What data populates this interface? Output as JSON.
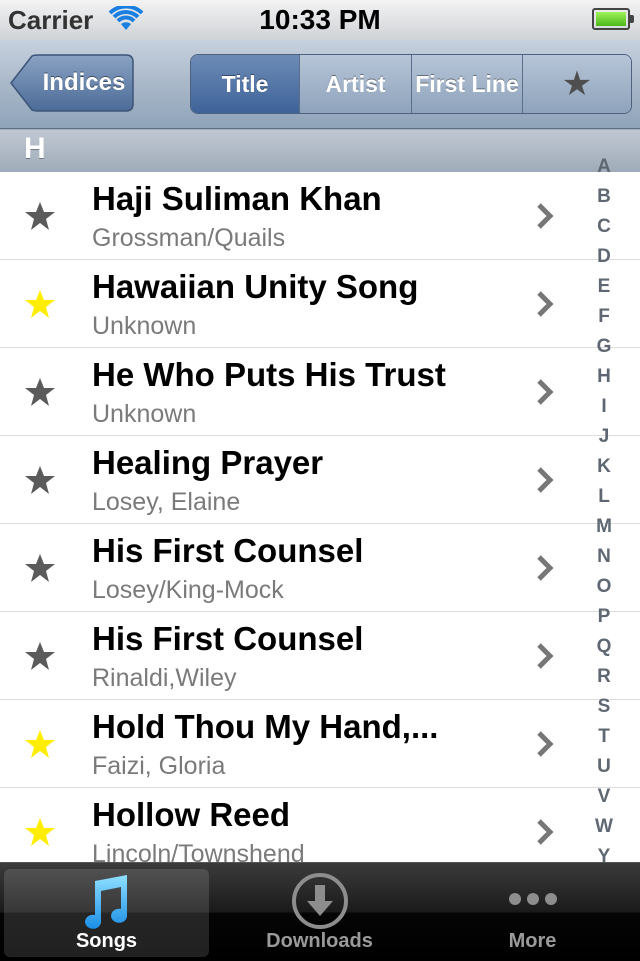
{
  "status": {
    "carrier": "Carrier",
    "time": "10:33 PM"
  },
  "nav": {
    "back_label": "Indices",
    "segments": [
      "Title",
      "Artist",
      "First Line",
      "★"
    ],
    "selected_segment": "Title"
  },
  "section": {
    "letter": "H"
  },
  "rows": [
    {
      "title": "Haji Suliman Khan",
      "subtitle": "Grossman/Quails",
      "favorite": false
    },
    {
      "title": "Hawaiian Unity Song",
      "subtitle": "Unknown",
      "favorite": true
    },
    {
      "title": "He Who Puts His Trust",
      "subtitle": "Unknown",
      "favorite": false
    },
    {
      "title": "Healing Prayer",
      "subtitle": "Losey, Elaine",
      "favorite": false
    },
    {
      "title": "His First Counsel",
      "subtitle": "Losey/King-Mock",
      "favorite": false
    },
    {
      "title": "His First Counsel",
      "subtitle": "Rinaldi,Wiley",
      "favorite": false
    },
    {
      "title": "Hold Thou My Hand,...",
      "subtitle": "Faizi, Gloria",
      "favorite": true
    },
    {
      "title": "Hollow Reed",
      "subtitle": "Lincoln/Townshend",
      "favorite": true
    }
  ],
  "index_letters": [
    "A",
    "B",
    "C",
    "D",
    "E",
    "F",
    "G",
    "H",
    "I",
    "J",
    "K",
    "L",
    "M",
    "N",
    "O",
    "P",
    "Q",
    "R",
    "S",
    "T",
    "U",
    "V",
    "W",
    "Y"
  ],
  "tabs": [
    {
      "label": "Songs",
      "icon": "music-note-icon",
      "selected": true
    },
    {
      "label": "Downloads",
      "icon": "download-icon",
      "selected": false
    },
    {
      "label": "More",
      "icon": "more-dots-icon",
      "selected": false
    }
  ],
  "colors": {
    "star_favorite": "#ffee00",
    "star_default": "#5a5a5a",
    "nav_selected": "#3e6399"
  }
}
